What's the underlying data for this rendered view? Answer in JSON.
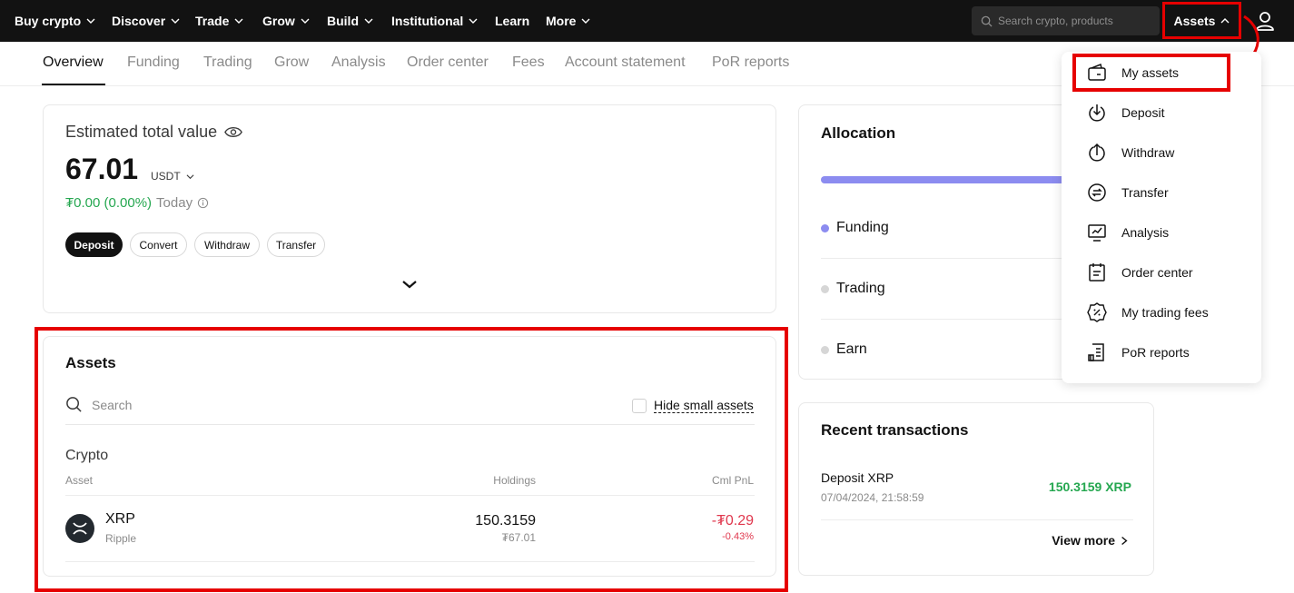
{
  "nav": {
    "items": [
      {
        "label": "Buy crypto",
        "has_chevron": true
      },
      {
        "label": "Discover",
        "has_chevron": true
      },
      {
        "label": "Trade",
        "has_chevron": true
      },
      {
        "label": "Grow",
        "has_chevron": true
      },
      {
        "label": "Build",
        "has_chevron": true
      },
      {
        "label": "Institutional",
        "has_chevron": true
      },
      {
        "label": "Learn",
        "has_chevron": false
      },
      {
        "label": "More",
        "has_chevron": true
      }
    ],
    "search_placeholder": "Search crypto, products",
    "assets_label": "Assets",
    "user_icon": "user-icon"
  },
  "subtabs": {
    "items": [
      "Overview",
      "Funding",
      "Trading",
      "Grow",
      "Analysis",
      "Order center",
      "Fees",
      "Account statement",
      "PoR reports"
    ],
    "active": "Overview"
  },
  "estimate": {
    "title": "Estimated total value",
    "value": "67.01",
    "unit": "USDT",
    "change": "₮0.00 (0.00%)",
    "change_period": "Today",
    "buttons": [
      "Deposit",
      "Convert",
      "Withdraw",
      "Transfer"
    ]
  },
  "assets": {
    "title": "Assets",
    "search_placeholder": "Search",
    "hide_small_label": "Hide small assets",
    "section_label": "Crypto",
    "columns": [
      "Asset",
      "Holdings",
      "Cml PnL"
    ],
    "rows": [
      {
        "symbol": "XRP",
        "name": "Ripple",
        "holdings": "150.3159",
        "holdings_value": "₮67.01",
        "pnl": "-₮0.29",
        "pnl_pct": "-0.43%"
      }
    ]
  },
  "allocation": {
    "title": "Allocation",
    "items": [
      {
        "label": "Funding",
        "color": "#8c8cf0"
      },
      {
        "label": "Trading",
        "color": "#d6d6d6"
      },
      {
        "label": "Earn",
        "color": "#d6d6d6"
      }
    ]
  },
  "recent": {
    "title": "Recent transactions",
    "tx_name": "Deposit XRP",
    "tx_time": "07/04/2024, 21:58:59",
    "tx_amount": "150.3159 XRP",
    "view_more": "View more"
  },
  "dropdown": {
    "items": [
      {
        "label": "My assets",
        "icon": "wallet-icon"
      },
      {
        "label": "Deposit",
        "icon": "deposit-icon"
      },
      {
        "label": "Withdraw",
        "icon": "withdraw-icon"
      },
      {
        "label": "Transfer",
        "icon": "transfer-icon"
      },
      {
        "label": "Analysis",
        "icon": "analysis-icon"
      },
      {
        "label": "Order center",
        "icon": "order-center-icon"
      },
      {
        "label": "My trading fees",
        "icon": "trading-fees-icon"
      },
      {
        "label": "PoR reports",
        "icon": "por-reports-icon"
      }
    ]
  },
  "colors": {
    "highlight": "#e60000",
    "positive": "#25a750",
    "negative": "#e0384e",
    "nav_bg": "#121212"
  }
}
